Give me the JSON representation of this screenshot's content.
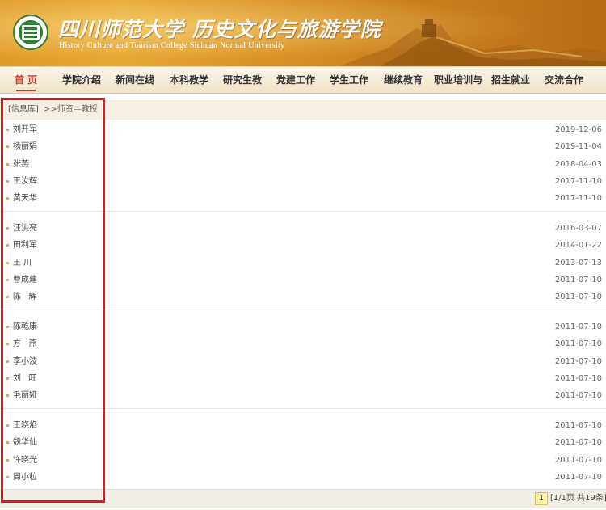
{
  "header": {
    "title_cn": "四川师范大学 历史文化与旅游学院",
    "title_en": "History Culture and Tourism College Sichuan Normal University",
    "logo_icon": "university-seal-icon"
  },
  "nav": {
    "items": [
      "首 页",
      "学院介绍",
      "新闻在线",
      "本科教学",
      "研究生教",
      "党建工作",
      "学生工作",
      "继续教育",
      "职业培训与",
      "招生就业",
      "交流合作"
    ],
    "active_color": "#c0392b"
  },
  "breadcrumb": {
    "library": "[信息库]",
    "path": ">>师资—教授"
  },
  "list": [
    {
      "name": "刘开军",
      "date": "2019-12-06"
    },
    {
      "name": "杨丽娟",
      "date": "2019-11-04"
    },
    {
      "name": "张燕",
      "date": "2018-04-03"
    },
    {
      "name": "王汝辉",
      "date": "2017-11-10"
    },
    {
      "name": "黄天华",
      "date": "2017-11-10"
    },
    {
      "name": "汪洪亮",
      "date": "2016-03-07"
    },
    {
      "name": "田利军",
      "date": "2014-01-22"
    },
    {
      "name": "王 川",
      "date": "2013-07-13"
    },
    {
      "name": "曹成建",
      "date": "2011-07-10"
    },
    {
      "name": "陈   辉",
      "date": "2011-07-10"
    },
    {
      "name": "陈乾康",
      "date": "2011-07-10"
    },
    {
      "name": "方   燕",
      "date": "2011-07-10"
    },
    {
      "name": "李小波",
      "date": "2011-07-10"
    },
    {
      "name": "刘   旺",
      "date": "2011-07-10"
    },
    {
      "name": "毛丽娅",
      "date": "2011-07-10"
    },
    {
      "name": "王晓焰",
      "date": "2011-07-10"
    },
    {
      "name": "魏华仙",
      "date": "2011-07-10"
    },
    {
      "name": "许晓光",
      "date": "2011-07-10"
    },
    {
      "name": "周小粒",
      "date": "2011-07-10"
    }
  ],
  "pager": {
    "current": "1",
    "info": "[1/1页 共19条]"
  },
  "colors": {
    "highlight_box": "#e01818",
    "banner": "#d99126"
  }
}
